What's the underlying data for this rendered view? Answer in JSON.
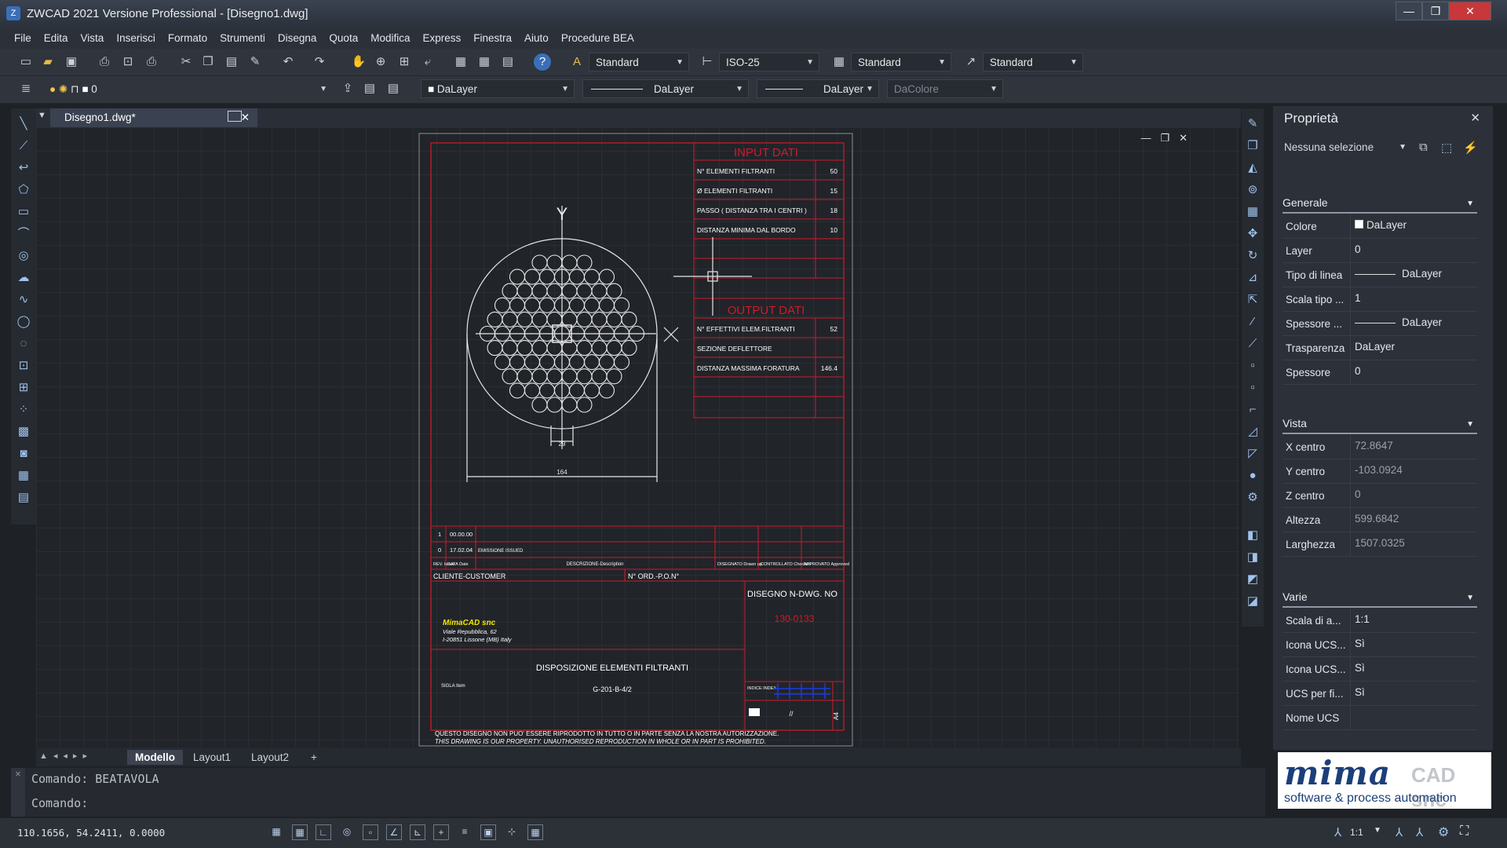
{
  "window": {
    "title": "ZWCAD 2021 Versione Professional - [Disegno1.dwg]",
    "controls": [
      "—",
      "❐",
      "✕"
    ]
  },
  "menu": [
    "File",
    "Edita",
    "Vista",
    "Inserisci",
    "Formato",
    "Strumenti",
    "Disegna",
    "Quota",
    "Modifica",
    "Express",
    "Finestra",
    "Aiuto",
    "Procedure BEA"
  ],
  "toolbar1": {
    "text_style": "Standard",
    "dim_style": "ISO-25",
    "table_style": "Standard",
    "mleader_style": "Standard"
  },
  "toolbar2": {
    "layer": "0",
    "color": "DaLayer",
    "linetype": "DaLayer",
    "lineweight": "DaLayer",
    "plotstyle": "DaColore"
  },
  "doc_tab": "Disegno1.dwg*",
  "drawing": {
    "input_header": "INPUT DATI",
    "input_rows": [
      {
        "label": "N° ELEMENTI FILTRANTI",
        "value": "50"
      },
      {
        "label": "Ø ELEMENTI FILTRANTI",
        "value": "15"
      },
      {
        "label": "PASSO ( DISTANZA TRA I CENTRI )",
        "value": "18"
      },
      {
        "label": "DISTANZA MINIMA DAL BORDO",
        "value": "10"
      }
    ],
    "output_header": "OUTPUT DATI",
    "output_rows": [
      {
        "label": "N° EFFETTIVI ELEM.FILTRANTI",
        "value": "52"
      },
      {
        "label": "SEZIONE DEFLETTORE",
        "value": ""
      },
      {
        "label": "DISTANZA MASSIMA FORATURA",
        "value": "146.4"
      }
    ],
    "axis_y": "Y",
    "axis_x": "X",
    "dim_small": "29",
    "dim_width": "164",
    "rev_rows": [
      {
        "rev": "1",
        "date": "00.00.00"
      },
      {
        "rev": "0",
        "date": "17.02.04",
        "desc": "EMISSIONE ISSUED"
      }
    ],
    "rev_header": {
      "rev": "REV. Issue",
      "date": "DATA Date",
      "desc": "DESCRIZIONE-Description",
      "drawn": "DISEGNATO Drawn up",
      "checked": "CONTROLLATO Checked",
      "approved": "APPROVATO Approved"
    },
    "customer_label": "CLIENTE-CUSTOMER",
    "order_label": "N° ORD.-P.O.N°",
    "drawing_no_label": "DISEGNO N-DWG. NO",
    "drawing_no": "130-0133",
    "company_name": "MimaCAD snc",
    "company_addr1": "Viale Repubblica, 62",
    "company_addr2": "I-20851 Lissone (MB) Italy",
    "drawing_title": "DISPOSIZIONE   ELEMENTI   FILTRANTI",
    "sigla_label": "SIGLA Item",
    "sigla_value": "G-201-B-4/2",
    "index_label": "INDICE INDEX",
    "sheet_value": "//",
    "format": "A4",
    "footer1": "QUESTO DISEGNO NON PUO' ESSERE RIPRODOTTO IN TUTTO O IN PARTE SENZA LA NOSTRA AUTORIZZAZIONE.",
    "footer2": "THIS DRAWING IS OUR PROPERTY. UNAUTHORISED REPRODUCTION IN WHOLE OR IN PART IS PROHIBITED."
  },
  "properties": {
    "title": "Proprietà",
    "selection": "Nessuna selezione",
    "sections": [
      {
        "name": "Generale",
        "rows": [
          {
            "key": "Colore",
            "value": "DaLayer"
          },
          {
            "key": "Layer",
            "value": "0"
          },
          {
            "key": "Tipo di linea",
            "value": "DaLayer"
          },
          {
            "key": "Scala tipo ...",
            "value": "1"
          },
          {
            "key": "Spessore ...",
            "value": "DaLayer"
          },
          {
            "key": "Trasparenza",
            "value": "DaLayer"
          },
          {
            "key": "Spessore",
            "value": "0"
          }
        ]
      },
      {
        "name": "Vista",
        "rows": [
          {
            "key": "X centro",
            "value": "72.8647"
          },
          {
            "key": "Y centro",
            "value": "-103.0924"
          },
          {
            "key": "Z centro",
            "value": "0"
          },
          {
            "key": "Altezza",
            "value": "599.6842"
          },
          {
            "key": "Larghezza",
            "value": "1507.0325"
          }
        ]
      },
      {
        "name": "Varie",
        "rows": [
          {
            "key": "Scala di a...",
            "value": "1:1"
          },
          {
            "key": "Icona UCS...",
            "value": "Sì"
          },
          {
            "key": "Icona UCS...",
            "value": "Sì"
          },
          {
            "key": "UCS per fi...",
            "value": "Sì"
          },
          {
            "key": "Nome UCS",
            "value": ""
          }
        ]
      }
    ]
  },
  "layout_tabs": [
    "Modello",
    "Layout1",
    "Layout2",
    "+"
  ],
  "command": {
    "history": "Comando: BEATAVOLA",
    "prompt": "Comando:"
  },
  "status": {
    "coords": "110.1656, 54.2411, 0.0000",
    "scale": "1:1"
  },
  "logo": {
    "brand": "mima",
    "suffix": "CAD snc",
    "tagline": "software & process automation"
  },
  "colors": {
    "accent": "#3a6fb8",
    "red": "#d01a2a",
    "canvas": "#212429"
  }
}
